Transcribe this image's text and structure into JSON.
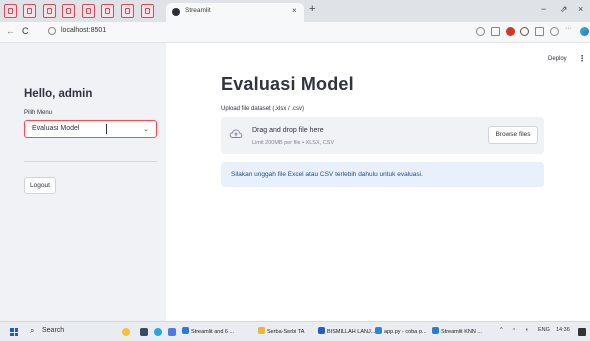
{
  "browser": {
    "active_tab_title": "Streamlit",
    "tab_close": "×",
    "new_tab": "+",
    "window_controls": [
      "−",
      "⇗",
      "×"
    ],
    "url": "localhost:8501",
    "nav": {
      "back": "←",
      "reload": "C"
    }
  },
  "sidebar": {
    "greeting": "Hello, admin",
    "menu_label": "Pilih Menu",
    "menu_selected": "Evaluasi Model",
    "logout_label": "Logout"
  },
  "header": {
    "deploy_label": "Deploy",
    "menu_glyph": "⋮"
  },
  "main": {
    "title": "Evaluasi Model",
    "upload_label": "Upload file dataset (.xlsx / .csv)",
    "drop_main": "Drag and drop file here",
    "drop_sub": "Limit 200MB per file • XLSX, CSV",
    "browse_label": "Browse files",
    "info_message": "Silakan unggah file Excel atau CSV terlebih dahulu untuk evaluasi."
  },
  "taskbar": {
    "search_label": "Search",
    "apps": [
      {
        "label": "Streamlit and 6 ...",
        "color": "#2b7bd1"
      },
      {
        "label": "Serba-Serbi TA",
        "color": "#e8b640"
      },
      {
        "label": "BISMILLAH LANJ...",
        "color": "#2a5bb8"
      },
      {
        "label": "app.py - coba p...",
        "color": "#2f84d4"
      },
      {
        "label": "Streamlit KNN ...",
        "color": "#2b7bd1"
      }
    ],
    "tray_lang": "ENG",
    "tray_time": "14:36"
  },
  "colors": {
    "accent": "#ff4b4b",
    "sidebar_bg": "#f0f2f6",
    "info_bg": "#e8f1fb",
    "info_text": "#1e4f87"
  }
}
